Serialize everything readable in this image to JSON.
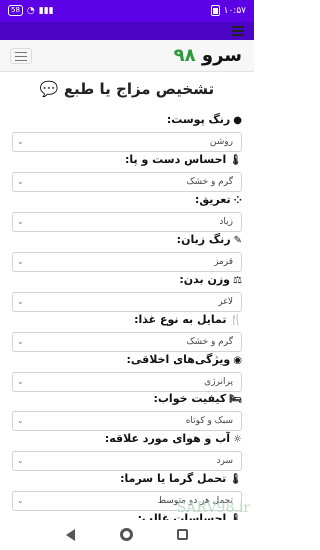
{
  "status_bar": {
    "time": "۱۰:۵۷",
    "battery_badge": "58"
  },
  "brand": {
    "name": "سرو",
    "number": "۹۸"
  },
  "page_title": "تشخیص مزاج یا طبع",
  "fields": [
    {
      "label": "رنگ پوست:",
      "value": "روشن",
      "icon": "drop-icon"
    },
    {
      "label": "احساس دست و پا:",
      "value": "گرم و خشک",
      "icon": "thermometer-icon"
    },
    {
      "label": "تعریق:",
      "value": "زیاد",
      "icon": "spinner-icon"
    },
    {
      "label": "رنگ زبان:",
      "value": "قرمز",
      "icon": "brush-icon"
    },
    {
      "label": "وزن بدن:",
      "value": "لاغر",
      "icon": "scale-icon"
    },
    {
      "label": "تمایل به نوع غذا:",
      "value": "گرم و خشک",
      "icon": "utensils-icon"
    },
    {
      "label": "ویژگی‌های اخلاقی:",
      "value": "پرانرژی",
      "icon": "user-circle-icon"
    },
    {
      "label": "کیفیت خواب:",
      "value": "سبک و کوتاه",
      "icon": "bed-icon"
    },
    {
      "label": "آب و هوای مورد علاقه:",
      "value": "سرد",
      "icon": "sun-icon"
    },
    {
      "label": "تحمل گرما یا سرما:",
      "value": "تحمل هر دو متوسط",
      "icon": "thermometer-icon"
    },
    {
      "label": "احساسات غالب:",
      "value": "",
      "icon": "thermometer-icon"
    }
  ],
  "watermark": "SARV98.ir"
}
